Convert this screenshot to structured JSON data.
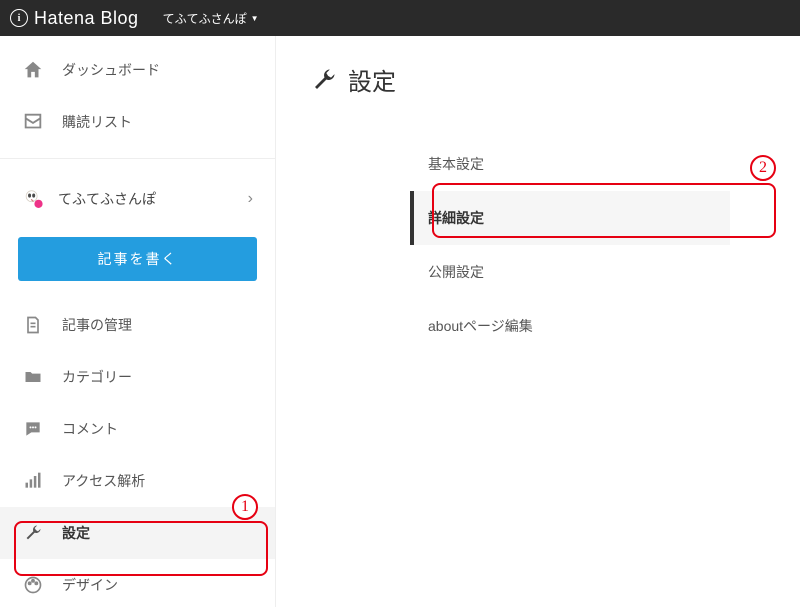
{
  "header": {
    "logo_letter": "i",
    "logo_text": "Hatena Blog",
    "blog_name": "てふてふさんぽ"
  },
  "sidebar": {
    "dashboard": "ダッシュボード",
    "subscriptions": "購読リスト",
    "blog_name": "てふてふさんぽ",
    "write_post": "記事を書く",
    "manage_posts": "記事の管理",
    "categories": "カテゴリー",
    "comments": "コメント",
    "analytics": "アクセス解析",
    "settings": "設定",
    "design": "デザイン"
  },
  "page": {
    "title": "設定",
    "submenu": {
      "basic": "基本設定",
      "advanced": "詳細設定",
      "publish": "公開設定",
      "about": "aboutページ編集"
    }
  },
  "annotations": {
    "one": "1",
    "two": "2"
  }
}
